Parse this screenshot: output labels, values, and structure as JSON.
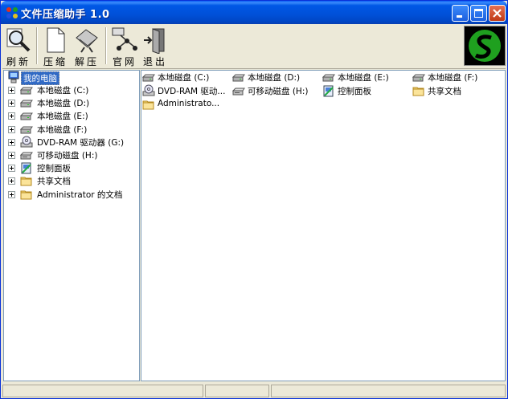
{
  "window": {
    "title": "文件压缩助手 1.0"
  },
  "toolbar": {
    "refresh": "刷新",
    "compress": "压缩",
    "extract": "解压",
    "website": "官网",
    "exit": "退出"
  },
  "tree": {
    "root": "我的电脑",
    "items": [
      {
        "label": "本地磁盘 (C:)",
        "icon": "hard-drive-icon"
      },
      {
        "label": "本地磁盘 (D:)",
        "icon": "hard-drive-icon"
      },
      {
        "label": "本地磁盘 (E:)",
        "icon": "hard-drive-icon"
      },
      {
        "label": "本地磁盘 (F:)",
        "icon": "hard-drive-icon"
      },
      {
        "label": "DVD-RAM 驱动器 (G:)",
        "icon": "dvd-drive-icon"
      },
      {
        "label": "可移动磁盘 (H:)",
        "icon": "removable-drive-icon"
      },
      {
        "label": "控制面板",
        "icon": "control-panel-icon"
      },
      {
        "label": "共享文档",
        "icon": "folder-icon"
      },
      {
        "label": "Administrator 的文档",
        "icon": "folder-icon"
      }
    ]
  },
  "content": {
    "items": [
      {
        "label": "本地磁盘 (C:)",
        "icon": "hard-drive-icon"
      },
      {
        "label": "本地磁盘 (D:)",
        "icon": "hard-drive-icon"
      },
      {
        "label": "本地磁盘 (E:)",
        "icon": "hard-drive-icon"
      },
      {
        "label": "本地磁盘 (F:)",
        "icon": "hard-drive-icon"
      },
      {
        "label": "DVD-RAM 驱动...",
        "icon": "dvd-drive-icon"
      },
      {
        "label": "可移动磁盘 (H:)",
        "icon": "removable-drive-icon"
      },
      {
        "label": "控制面板",
        "icon": "control-panel-icon"
      },
      {
        "label": "共享文档",
        "icon": "folder-icon"
      },
      {
        "label": "Administrato...",
        "icon": "folder-icon"
      }
    ]
  },
  "colors": {
    "titlebar": "#0054e3",
    "selection": "#316ac5",
    "face": "#ece9d8"
  }
}
